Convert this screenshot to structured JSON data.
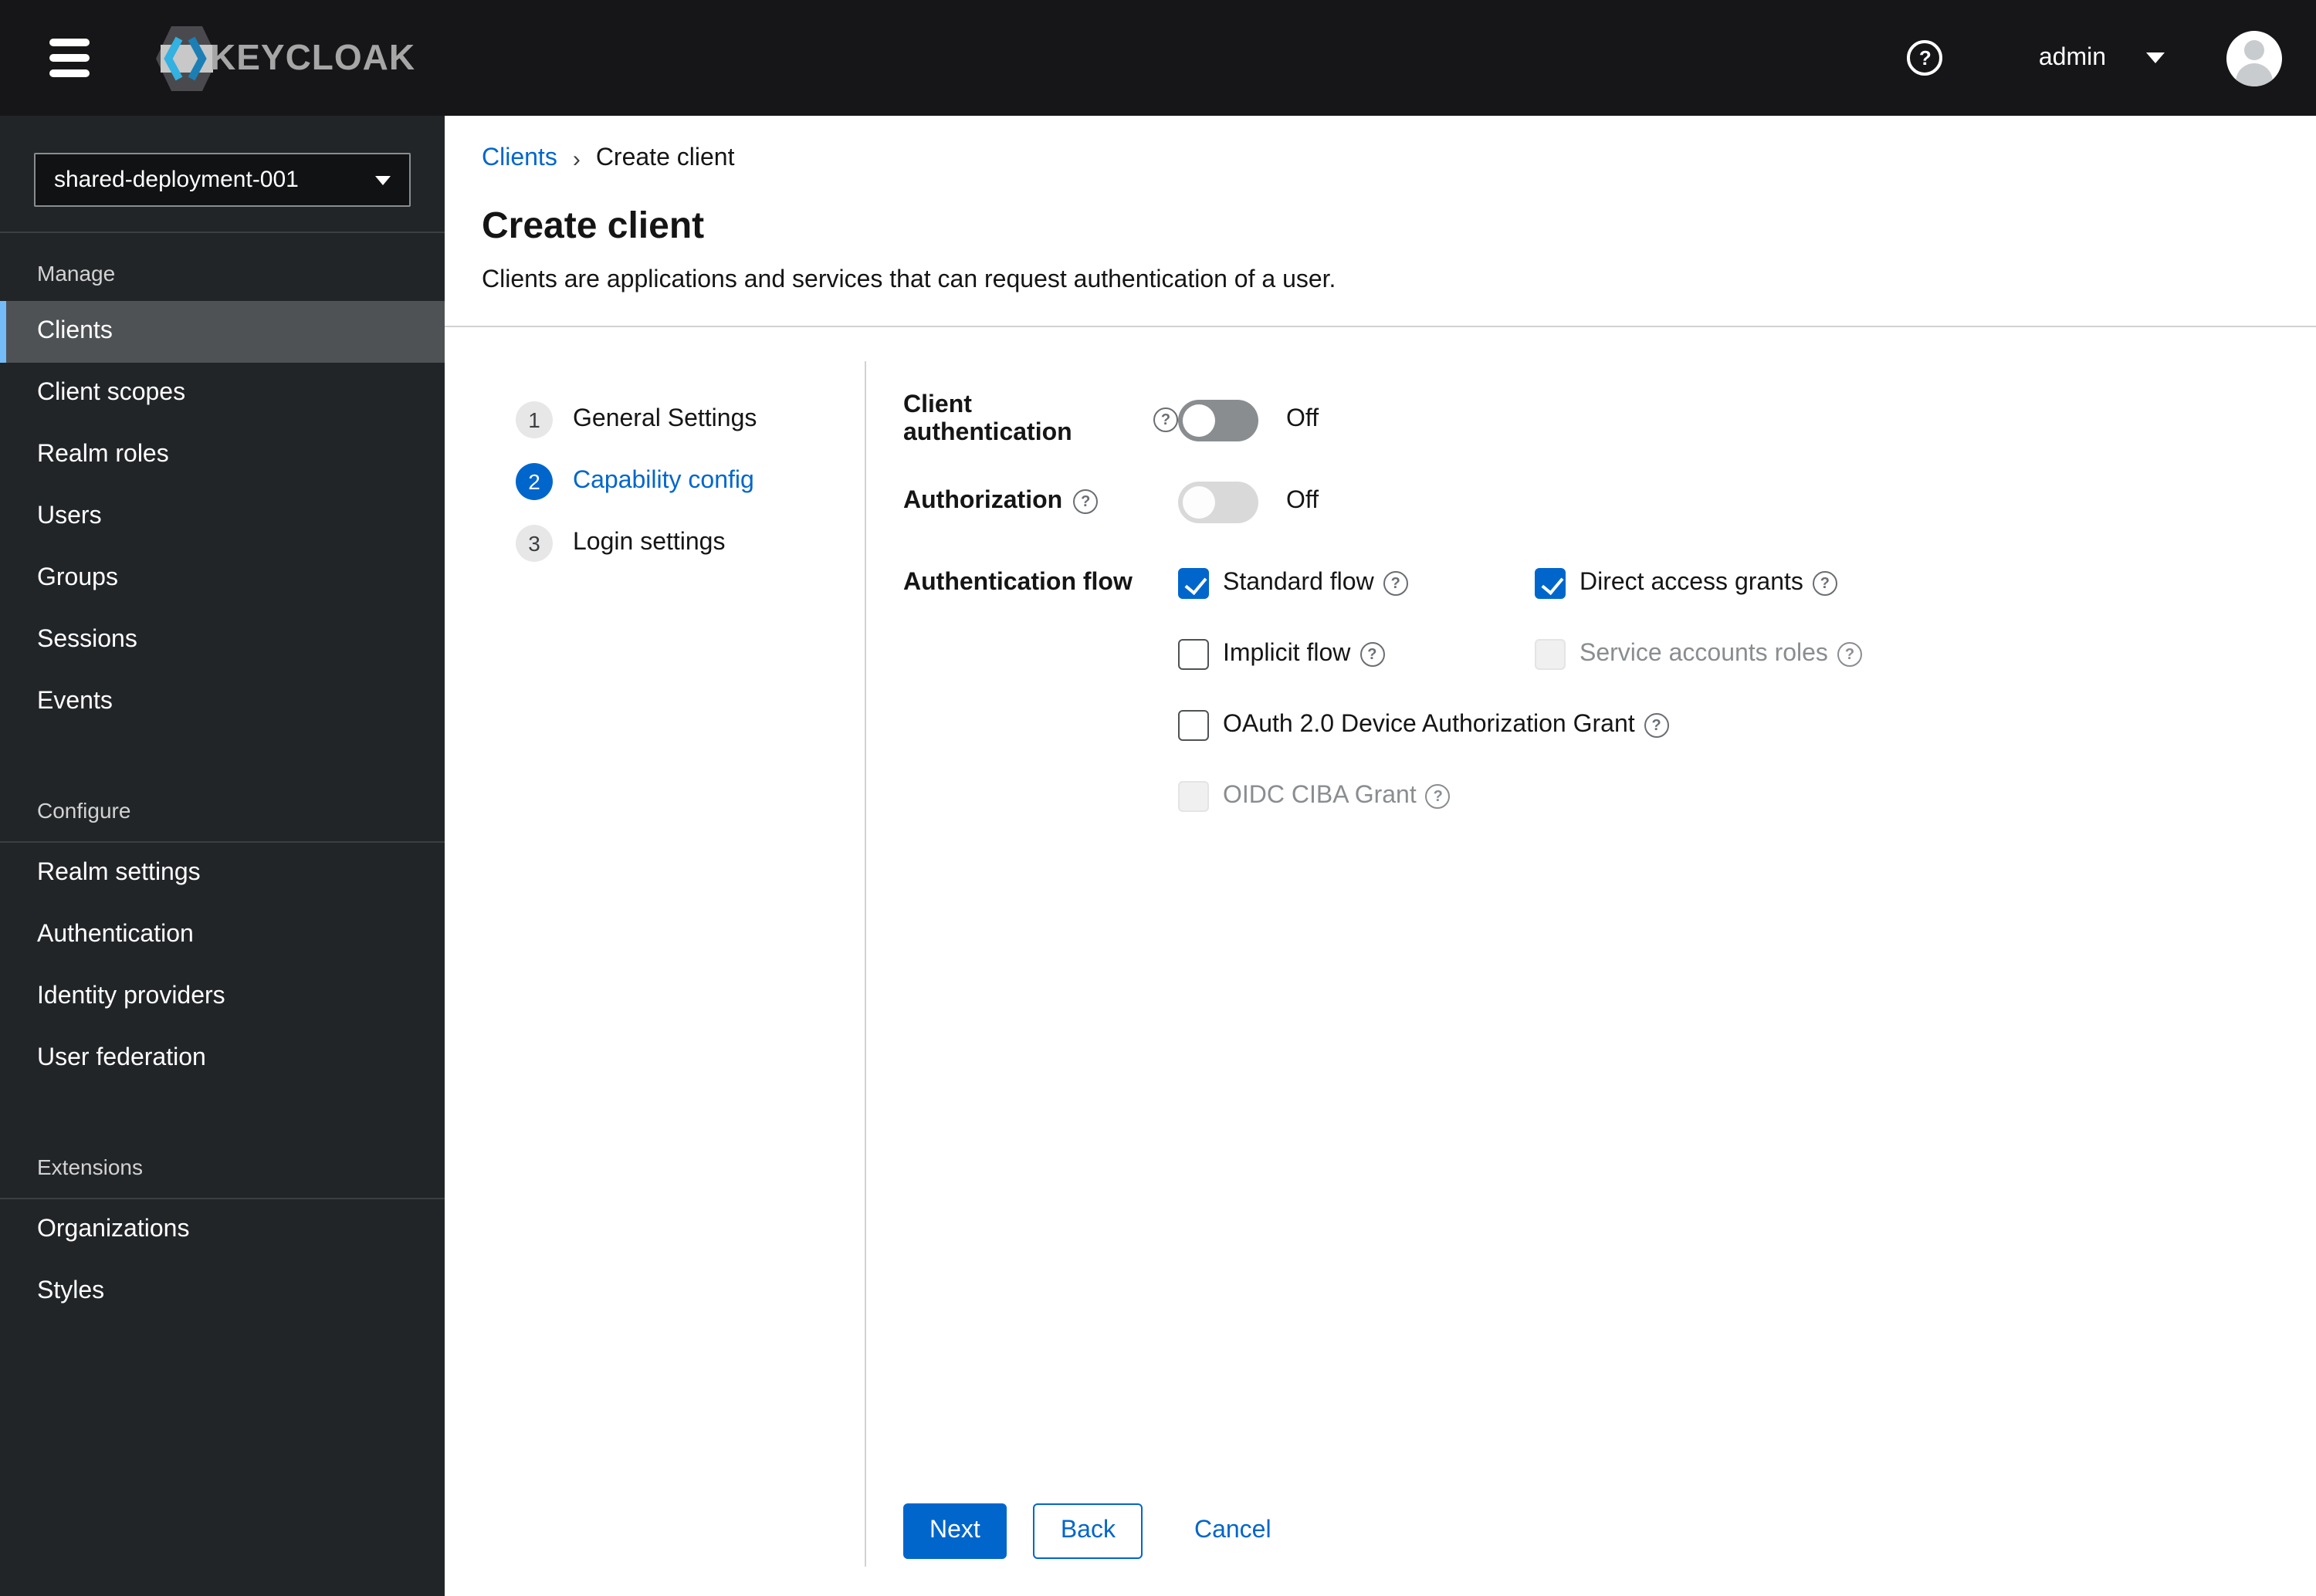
{
  "masthead": {
    "brand": "KEYCLOAK",
    "username": "admin"
  },
  "sidebar": {
    "realm_selector": {
      "value": "shared-deployment-001"
    },
    "sections": [
      {
        "label": "Manage",
        "items": [
          {
            "label": "Clients",
            "active": true
          },
          {
            "label": "Client scopes"
          },
          {
            "label": "Realm roles"
          },
          {
            "label": "Users"
          },
          {
            "label": "Groups"
          },
          {
            "label": "Sessions"
          },
          {
            "label": "Events"
          }
        ]
      },
      {
        "label": "Configure",
        "items": [
          {
            "label": "Realm settings"
          },
          {
            "label": "Authentication"
          },
          {
            "label": "Identity providers"
          },
          {
            "label": "User federation"
          }
        ]
      },
      {
        "label": "Extensions",
        "items": [
          {
            "label": "Organizations"
          },
          {
            "label": "Styles"
          }
        ]
      }
    ]
  },
  "breadcrumb": {
    "items": [
      "Clients",
      "Create client"
    ]
  },
  "page": {
    "title": "Create client",
    "subtitle": "Clients are applications and services that can request authentication of a user."
  },
  "wizard": {
    "steps": [
      {
        "number": "1",
        "label": "General Settings",
        "state": "default"
      },
      {
        "number": "2",
        "label": "Capability config",
        "state": "current"
      },
      {
        "number": "3",
        "label": "Login settings",
        "state": "default"
      }
    ]
  },
  "form": {
    "client_authentication": {
      "label": "Client authentication",
      "value": "Off",
      "disabled": false
    },
    "authorization": {
      "label": "Authorization",
      "value": "Off",
      "disabled": true
    },
    "authentication_flow": {
      "label": "Authentication flow",
      "options": [
        {
          "label": "Standard flow",
          "checked": true,
          "disabled": false
        },
        {
          "label": "Direct access grants",
          "checked": true,
          "disabled": false
        },
        {
          "label": "Implicit flow",
          "checked": false,
          "disabled": false
        },
        {
          "label": "Service accounts roles",
          "checked": false,
          "disabled": true
        },
        {
          "label": "OAuth 2.0 Device Authorization Grant",
          "checked": false,
          "disabled": false
        },
        {
          "label": "OIDC CIBA Grant",
          "checked": false,
          "disabled": true
        }
      ]
    }
  },
  "actions": {
    "next": "Next",
    "back": "Back",
    "cancel": "Cancel"
  },
  "colors": {
    "accent": "#0066cc",
    "masthead_bg": "#161618",
    "sidebar_bg": "#222528",
    "active_item_bg": "#4f5255",
    "active_item_border": "#73bcf7",
    "checked_checkbox": "#0066cc"
  }
}
